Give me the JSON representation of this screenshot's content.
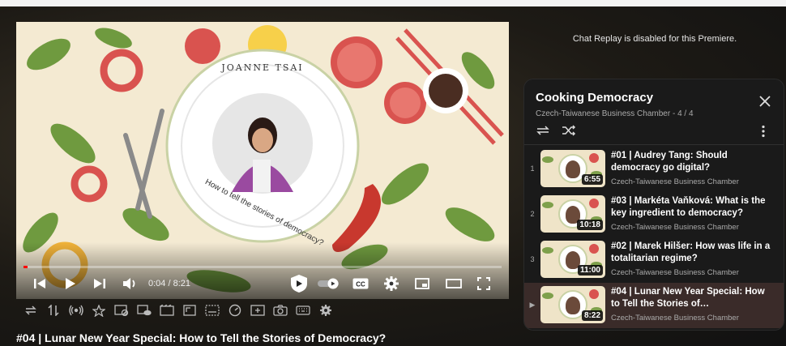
{
  "player": {
    "time": "0:04 / 8:21",
    "progress_fraction": 0.008,
    "title": "#04 | Lunar New Year Special: How to Tell the Stories of Democracy?"
  },
  "artwork": {
    "speaker": "JOANNE TSAI",
    "tagline": "How to tell the stories of democracy?"
  },
  "chat": {
    "message": "Chat Replay is disabled for this Premiere."
  },
  "playlist": {
    "title": "Cooking Democracy",
    "subtitle": "Czech-Taiwanese Business Chamber - 4 / 4",
    "items": [
      {
        "index": "1",
        "title": "#01 | Audrey Tang: Should democracy go digital?",
        "channel": "Czech-Taiwanese Business Chamber",
        "duration": "6:55"
      },
      {
        "index": "2",
        "title": "#03 | Markéta Vaňková: What is the key ingredient to democracy?",
        "channel": "Czech-Taiwanese Business Chamber",
        "duration": "10:18"
      },
      {
        "index": "3",
        "title": "#02 | Marek Hilšer: How was life in a totalitarian regime?",
        "channel": "Czech-Taiwanese Business Chamber",
        "duration": "11:00"
      },
      {
        "index": "▶",
        "title": "#04 | Lunar New Year Special: How to Tell the Stories of…",
        "channel": "Czech-Taiwanese Business Chamber",
        "duration": "8:22"
      }
    ]
  },
  "colors": {
    "progress": "#ff0000",
    "current_item_bg": "#3a2b29",
    "panel_bg": "#1a1a1a"
  },
  "icons": {
    "controls": [
      "previous-icon",
      "play-icon",
      "next-icon",
      "volume-icon",
      "sponsorblock-icon",
      "autoplay-toggle",
      "captions-icon",
      "settings-icon",
      "miniplayer-icon",
      "theater-icon",
      "fullscreen-icon"
    ],
    "toolbar": [
      "repeat-icon",
      "sort-icon",
      "broadcast-icon",
      "star-icon",
      "no-frames-icon",
      "preview-icon",
      "film-icon",
      "crop-icon",
      "subtitles-icon",
      "speed-icon",
      "plus-box-icon",
      "camera-icon",
      "keyboard-icon",
      "gear-icon"
    ]
  }
}
